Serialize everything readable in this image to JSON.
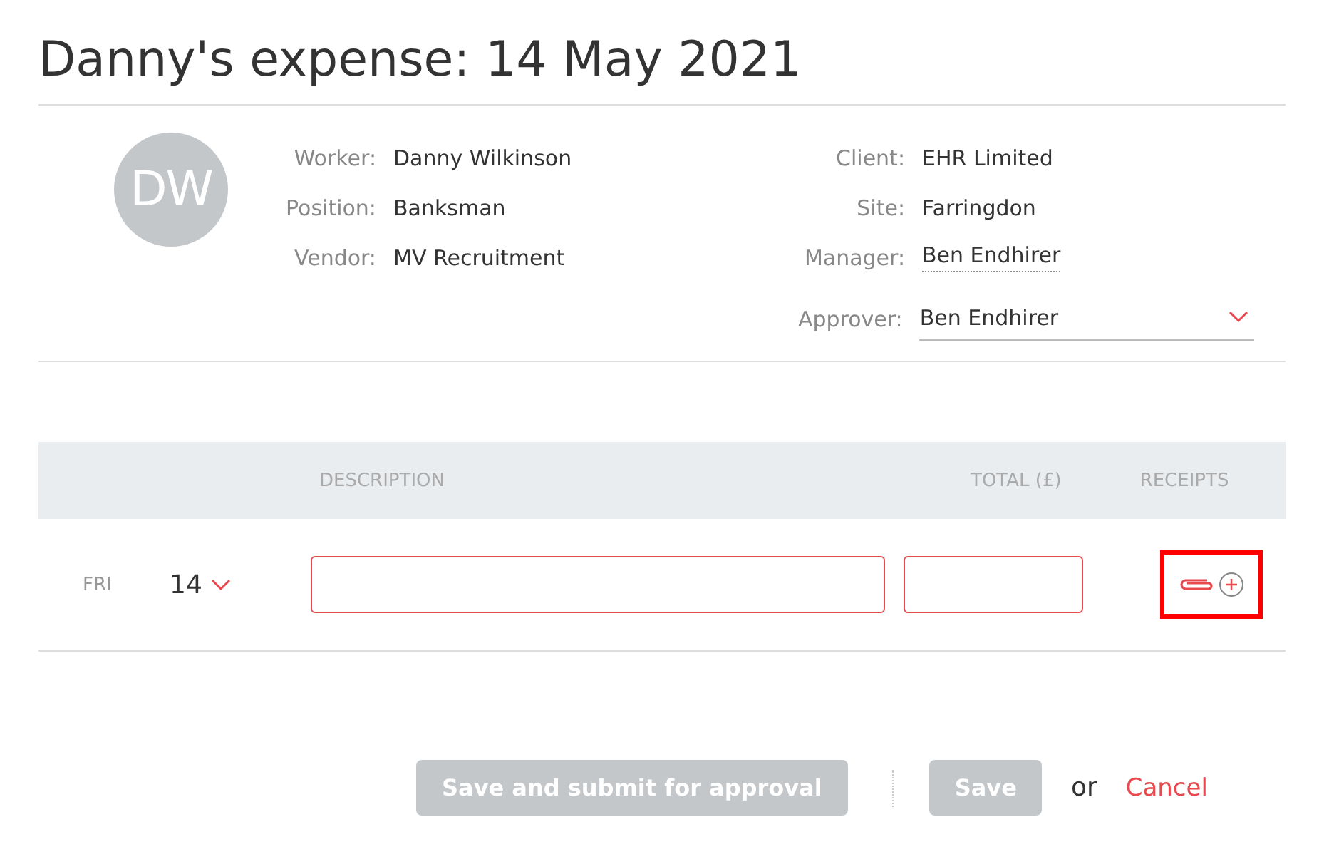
{
  "title": "Danny's expense: 14 May 2021",
  "avatar": {
    "initials": "DW"
  },
  "left_fields": [
    {
      "label": "Worker:",
      "value": "Danny Wilkinson"
    },
    {
      "label": "Position:",
      "value": "Banksman"
    },
    {
      "label": "Vendor:",
      "value": "MV Recruitment"
    }
  ],
  "right_fields": [
    {
      "label": "Client:",
      "value": "EHR Limited",
      "kind": "text"
    },
    {
      "label": "Site:",
      "value": "Farringdon",
      "kind": "text"
    },
    {
      "label": "Manager:",
      "value": "Ben Endhirer",
      "kind": "link"
    },
    {
      "label": "Approver:",
      "value": "Ben Endhirer",
      "kind": "select"
    }
  ],
  "table": {
    "columns": [
      "DESCRIPTION",
      "TOTAL (£)",
      "RECEIPTS"
    ],
    "rows": [
      {
        "day": "FRI",
        "date": "14",
        "highlighted": true
      }
    ]
  },
  "actions": {
    "submit": {
      "label": "Save and submit for approval",
      "disabled": true
    },
    "save": {
      "label": "Save",
      "disabled": true
    },
    "or": "or",
    "cancel": "Cancel"
  }
}
